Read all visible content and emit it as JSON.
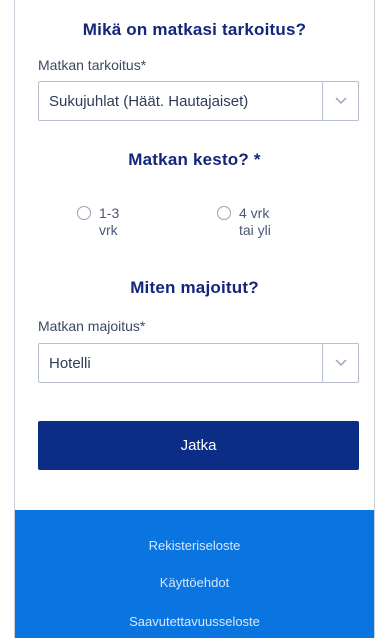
{
  "purpose": {
    "heading": "Mikä on matkasi tarkoitus?",
    "field_label": "Matkan tarkoitus*",
    "selected_value": "Sukujuhlat (Häät. Hautajaiset)"
  },
  "duration": {
    "heading": "Matkan kesto? *",
    "options": [
      {
        "line1": "1-3",
        "line2": "vrk"
      },
      {
        "line1": "4 vrk",
        "line2": "tai yli"
      }
    ]
  },
  "accommodation": {
    "heading": "Miten majoitut?",
    "field_label": "Matkan majoitus*",
    "selected_value": "Hotelli"
  },
  "continue_button": "Jatka",
  "footer": {
    "links": [
      "Rekisteriseloste",
      "Käyttöehdot",
      "Saavutettavuusseloste"
    ]
  },
  "colors": {
    "heading": "#14257a",
    "primary_button": "#0c2d86",
    "footer_background": "#0a74e0"
  },
  "icons": [
    "chevron-down-icon",
    "radio-unchecked-icon"
  ]
}
